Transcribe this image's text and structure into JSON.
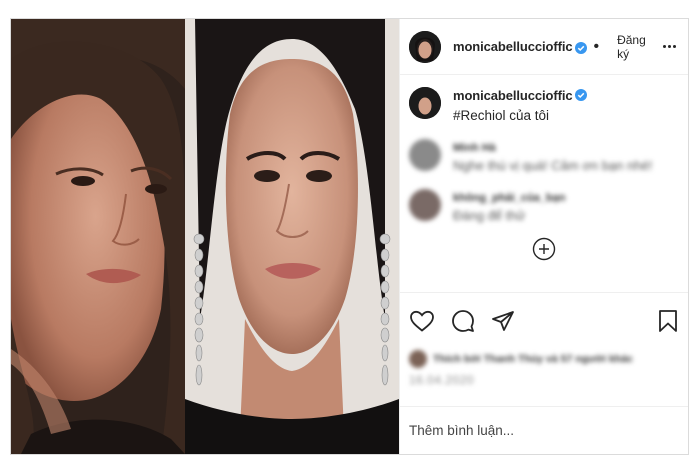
{
  "post": {
    "username": "monicabelluccioffic",
    "follow_label": "Đăng ký",
    "dot": "•",
    "caption": "#Rechiol của tôi",
    "comments": [
      {
        "user": "Minh Hà",
        "text": "Nghe thú vị quá! Cảm ơn bạn nhé!"
      },
      {
        "user": "không_phải_của_bạn",
        "text": "Đáng để thử"
      }
    ],
    "likes": "Thích bởi Thanh Thủy và 57 người khác",
    "date": "16.04.2020",
    "add_comment_placeholder": "Thêm bình luận..."
  },
  "icons": {
    "verified": "verified-badge-icon",
    "more": "more-options-icon",
    "load_more": "load-more-comments-icon",
    "like": "heart-icon",
    "comment": "comment-icon",
    "share": "share-icon",
    "save": "bookmark-icon"
  },
  "colors": {
    "verified": "#3897f0",
    "text": "#262626",
    "muted": "#8e8e8e",
    "border": "#dbdbdb"
  }
}
